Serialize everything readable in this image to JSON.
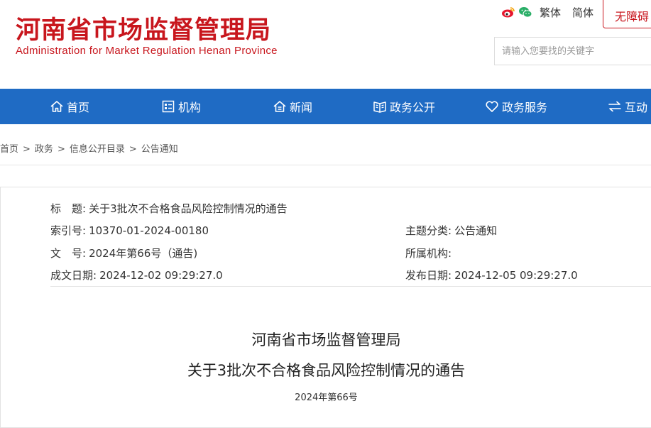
{
  "header": {
    "logo_cn": "河南省市场监督管理局",
    "logo_en": "Administration for Market Regulation Henan Province",
    "lang_traditional": "繁体",
    "lang_simplified": "简体",
    "accessibility": "无障碍",
    "search_placeholder": "请输入您要找的关键字",
    "brand_color": "#c8161d"
  },
  "nav": {
    "color": "#1f6bc4",
    "items": [
      {
        "label": "首页",
        "icon": "home-icon"
      },
      {
        "label": "机构",
        "icon": "building-list-icon"
      },
      {
        "label": "新闻",
        "icon": "news-icon"
      },
      {
        "label": "政务公开",
        "icon": "open-book-icon"
      },
      {
        "label": "政务服务",
        "icon": "heart-icon"
      },
      {
        "label": "互动",
        "icon": "exchange-arrows-icon"
      }
    ]
  },
  "breadcrumb": [
    "首页",
    "政务",
    "信息公开目录",
    "公告通知"
  ],
  "meta": {
    "title_label": "标　题:",
    "title_value": "关于3批次不合格食品风险控制情况的通告",
    "index_label": "索引号:",
    "index_value": "10370-01-2024-00180",
    "category_label": "主题分类:",
    "category_value": "公告通知",
    "docno_label": "文　号:",
    "docno_value": "2024年第66号（通告)",
    "org_label": "所属机构:",
    "org_value": "",
    "created_label": "成文日期:",
    "created_value": "2024-12-02 09:29:27.0",
    "published_label": "发布日期:",
    "published_value": "2024-12-05 09:29:27.0"
  },
  "document": {
    "title_line1": "河南省市场监督管理局",
    "title_line2": "关于3批次不合格食品风险控制情况的通告",
    "number": "2024年第66号"
  }
}
